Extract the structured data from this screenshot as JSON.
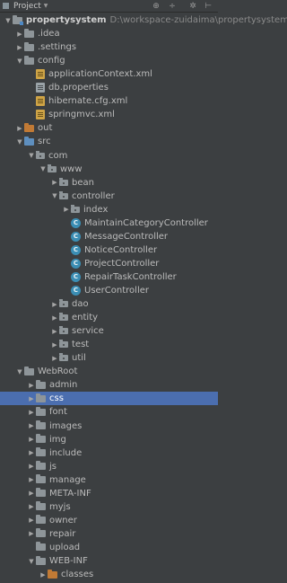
{
  "panel": {
    "title": "Project",
    "dropdown_icon": "chevron-down-icon",
    "toolbar_icons": [
      "target-icon",
      "collapse-all-icon",
      "gear-icon",
      "hide-icon"
    ]
  },
  "colors": {
    "background": "#3c3f41",
    "selection": "#4b6eaf",
    "folder": "#8e9599",
    "source_folder": "#5e8fbf",
    "excluded_folder": "#c17a35",
    "class_icon": "#3b8eb4",
    "xml_icon": "#cfa446"
  },
  "tree": [
    {
      "label": "propertysystem",
      "path": "D:\\workspace-zuidaima\\propertysystem",
      "depth": 0,
      "expanded": true,
      "icon": "module-folder-icon",
      "bold": true
    },
    {
      "label": ".idea",
      "depth": 1,
      "expanded": false,
      "icon": "folder-icon"
    },
    {
      "label": ".settings",
      "depth": 1,
      "expanded": false,
      "icon": "folder-icon"
    },
    {
      "label": "config",
      "depth": 1,
      "expanded": true,
      "icon": "folder-icon"
    },
    {
      "label": "applicationContext.xml",
      "depth": 2,
      "icon": "xml-icon"
    },
    {
      "label": "db.properties",
      "depth": 2,
      "icon": "properties-icon"
    },
    {
      "label": "hibernate.cfg.xml",
      "depth": 2,
      "icon": "xml-icon"
    },
    {
      "label": "springmvc.xml",
      "depth": 2,
      "icon": "xml-icon"
    },
    {
      "label": "out",
      "depth": 1,
      "expanded": false,
      "icon": "excluded-folder-icon"
    },
    {
      "label": "src",
      "depth": 1,
      "expanded": true,
      "icon": "source-folder-icon"
    },
    {
      "label": "com",
      "depth": 2,
      "expanded": true,
      "icon": "package-icon"
    },
    {
      "label": "www",
      "depth": 3,
      "expanded": true,
      "icon": "package-icon"
    },
    {
      "label": "bean",
      "depth": 4,
      "expanded": false,
      "icon": "package-icon"
    },
    {
      "label": "controller",
      "depth": 4,
      "expanded": true,
      "icon": "package-icon"
    },
    {
      "label": "index",
      "depth": 5,
      "expanded": false,
      "icon": "package-icon"
    },
    {
      "label": "MaintainCategoryController",
      "depth": 5,
      "icon": "class-icon"
    },
    {
      "label": "MessageController",
      "depth": 5,
      "icon": "class-icon"
    },
    {
      "label": "NoticeController",
      "depth": 5,
      "icon": "class-icon"
    },
    {
      "label": "ProjectController",
      "depth": 5,
      "icon": "class-icon"
    },
    {
      "label": "RepairTaskController",
      "depth": 5,
      "icon": "class-icon"
    },
    {
      "label": "UserController",
      "depth": 5,
      "icon": "class-icon"
    },
    {
      "label": "dao",
      "depth": 4,
      "expanded": false,
      "icon": "package-icon"
    },
    {
      "label": "entity",
      "depth": 4,
      "expanded": false,
      "icon": "package-icon"
    },
    {
      "label": "service",
      "depth": 4,
      "expanded": false,
      "icon": "package-icon"
    },
    {
      "label": "test",
      "depth": 4,
      "expanded": false,
      "icon": "package-icon"
    },
    {
      "label": "util",
      "depth": 4,
      "expanded": false,
      "icon": "package-icon"
    },
    {
      "label": "WebRoot",
      "depth": 1,
      "expanded": true,
      "icon": "folder-icon"
    },
    {
      "label": "admin",
      "depth": 2,
      "expanded": false,
      "icon": "folder-icon"
    },
    {
      "label": "css",
      "depth": 2,
      "expanded": false,
      "icon": "folder-icon",
      "selected": true
    },
    {
      "label": "font",
      "depth": 2,
      "expanded": false,
      "icon": "folder-icon"
    },
    {
      "label": "images",
      "depth": 2,
      "expanded": false,
      "icon": "folder-icon"
    },
    {
      "label": "img",
      "depth": 2,
      "expanded": false,
      "icon": "folder-icon"
    },
    {
      "label": "include",
      "depth": 2,
      "expanded": false,
      "icon": "folder-icon"
    },
    {
      "label": "js",
      "depth": 2,
      "expanded": false,
      "icon": "folder-icon"
    },
    {
      "label": "manage",
      "depth": 2,
      "expanded": false,
      "icon": "folder-icon"
    },
    {
      "label": "META-INF",
      "depth": 2,
      "expanded": false,
      "icon": "folder-icon"
    },
    {
      "label": "myjs",
      "depth": 2,
      "expanded": false,
      "icon": "folder-icon"
    },
    {
      "label": "owner",
      "depth": 2,
      "expanded": false,
      "icon": "folder-icon"
    },
    {
      "label": "repair",
      "depth": 2,
      "expanded": false,
      "icon": "folder-icon"
    },
    {
      "label": "upload",
      "depth": 2,
      "icon": "folder-icon"
    },
    {
      "label": "WEB-INF",
      "depth": 2,
      "expanded": true,
      "icon": "folder-icon"
    },
    {
      "label": "classes",
      "depth": 3,
      "expanded": false,
      "icon": "excluded-folder-icon"
    }
  ]
}
